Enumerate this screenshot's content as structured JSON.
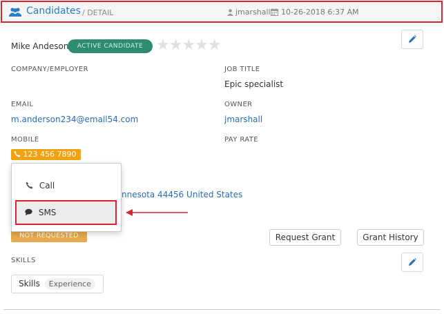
{
  "header": {
    "title": "Candidates",
    "subtitle": "/ DETAIL",
    "user": "jmarshall",
    "datetime": "10-26-2018 6:37 AM",
    "icons": [
      "users-icon",
      "user-icon",
      "calendar-icon"
    ]
  },
  "candidate": {
    "name": "Mike Andeson",
    "status": "ACTIVE CANDIDATE",
    "rating": 0,
    "rating_max": 5,
    "stars": "★★★★★"
  },
  "fields": {
    "company_label": "COMPANY/EMPLOYER",
    "company_value": "",
    "job_title_label": "JOB TITLE",
    "job_title_value": "Epic specialist",
    "email_label": "EMAIL",
    "email_value": "m.anderson234@email54.com",
    "owner_label": "OWNER",
    "owner_value": "jmarshall",
    "mobile_label": "MOBILE",
    "mobile_value": "123 456 7890",
    "pay_rate_label": "PAY RATE",
    "pay_rate_value": "",
    "address_partial": "nnesota 44456 United States",
    "grant_status": "NOT REQUESTED"
  },
  "actions": {
    "request_grant": "Request Grant",
    "grant_history": "Grant History"
  },
  "skills": {
    "label": "SKILLS",
    "chip_name": "Skills",
    "chip_level": "Experience"
  },
  "menu": {
    "call_label": "Call",
    "sms_label": "SMS"
  },
  "colors": {
    "header_border": "#d9232e",
    "accent_blue": "#2a7fc4",
    "active_badge": "#2e8b6f",
    "phone_badge": "#f2a20e",
    "not_requested_badge": "#e9a94c"
  }
}
